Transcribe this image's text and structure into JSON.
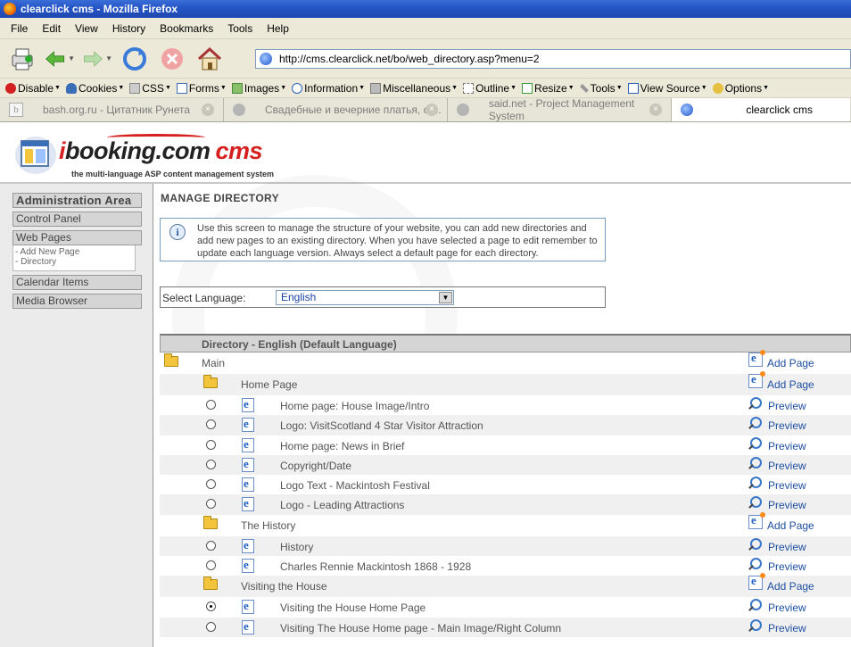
{
  "window": {
    "title": "clearclick cms - Mozilla Firefox"
  },
  "menubar": [
    "File",
    "Edit",
    "View",
    "History",
    "Bookmarks",
    "Tools",
    "Help"
  ],
  "nav": {
    "url": "http://cms.clearclick.net/bo/web_directory.asp?menu=2"
  },
  "devbar": [
    {
      "label": "Disable",
      "icon": "disable-icon",
      "color": "#d42020"
    },
    {
      "label": "Cookies",
      "icon": "cookies-icon",
      "color": "#3a6fb8"
    },
    {
      "label": "CSS",
      "icon": "css-icon",
      "color": "#888"
    },
    {
      "label": "Forms",
      "icon": "forms-icon",
      "color": "#3a6fb8"
    },
    {
      "label": "Images",
      "icon": "images-icon",
      "color": "#4a8a3a"
    },
    {
      "label": "Information",
      "icon": "info-icon",
      "color": "#2a5fb8"
    },
    {
      "label": "Miscellaneous",
      "icon": "misc-icon",
      "color": "#777"
    },
    {
      "label": "Outline",
      "icon": "outline-icon",
      "color": "#777"
    },
    {
      "label": "Resize",
      "icon": "resize-icon",
      "color": "#3a9a3a"
    },
    {
      "label": "Tools",
      "icon": "tools-icon",
      "color": "#777"
    },
    {
      "label": "View Source",
      "icon": "source-icon",
      "color": "#2a5fb8"
    },
    {
      "label": "Options",
      "icon": "options-icon",
      "color": "#d4a020"
    }
  ],
  "tabs": [
    {
      "label": "bash.org.ru - Цитатник Рунета",
      "icon": "b"
    },
    {
      "label": "Свадебные и вечерние платья, ст...",
      "icon": ""
    },
    {
      "label": "said.net - Project Management System",
      "icon": ""
    },
    {
      "label": "clearclick cms",
      "icon": "",
      "active": true
    }
  ],
  "header": {
    "logo_i": "i",
    "logo_main": "booking.com",
    "logo_cms": "cms",
    "tagline": "the multi-language ASP content management system"
  },
  "sidebar": {
    "admin": "Administration Area",
    "control": "Control Panel",
    "web_pages": "Web Pages",
    "add_new": "- Add New Page",
    "directory": "- Directory",
    "calendar": "Calendar Items",
    "media": "Media Browser"
  },
  "main": {
    "title": "MANAGE DIRECTORY",
    "info": "Use this screen to manage the structure of your website, you can add new directories and add new pages to an existing directory. When you have selected a page to edit remember to update each language version. Always select a default page for each directory.",
    "lang_label": "Select Language:",
    "lang_value": "English",
    "dir_header": "Directory - English (Default Language)",
    "add_page": "Add Page",
    "preview": "Preview"
  },
  "rows": [
    {
      "type": "dir",
      "level": 0,
      "label": "Main"
    },
    {
      "type": "dir",
      "level": 1,
      "label": "Home Page"
    },
    {
      "type": "page",
      "label": "Home page: House Image/Intro",
      "checked": false
    },
    {
      "type": "page",
      "label": "Logo: VisitScotland 4 Star Visitor Attraction",
      "checked": false
    },
    {
      "type": "page",
      "label": "Home page: News in Brief",
      "checked": false
    },
    {
      "type": "page",
      "label": "Copyright/Date",
      "checked": false
    },
    {
      "type": "page",
      "label": "Logo Text - Mackintosh Festival",
      "checked": false
    },
    {
      "type": "page",
      "label": "Logo - Leading Attractions",
      "checked": false
    },
    {
      "type": "dir",
      "level": 1,
      "label": "The History"
    },
    {
      "type": "page",
      "label": "History",
      "checked": false
    },
    {
      "type": "page",
      "label": "Charles Rennie Mackintosh 1868 - 1928",
      "checked": false
    },
    {
      "type": "dir",
      "level": 1,
      "label": "Visiting the House"
    },
    {
      "type": "page",
      "label": "Visiting the House Home Page",
      "checked": true
    },
    {
      "type": "page",
      "label": "Visiting The House Home page - Main Image/Right Column",
      "checked": false
    }
  ]
}
